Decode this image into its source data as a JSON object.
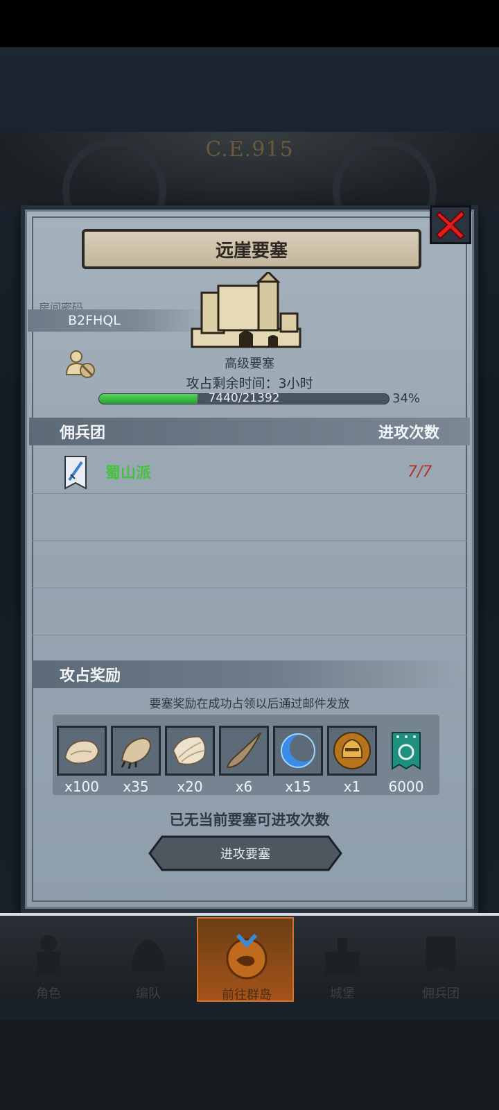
{
  "header": {
    "era": "C.E.915"
  },
  "dialog": {
    "title": "远崖要塞",
    "room_label": "房间密码",
    "room_code": "B2FHQL",
    "fortress_type": "高级要塞",
    "time_left": "攻占剩余时间：3小时",
    "progress": {
      "text": "7440/21392",
      "percent_label": "34%",
      "fraction": 0.34
    }
  },
  "mercenary_section": {
    "left_header": "佣兵团",
    "right_header": "进攻次数",
    "rows": [
      {
        "name": "蜀山派",
        "attacks": "7/7"
      }
    ]
  },
  "rewards": {
    "header": "攻占奖励",
    "note": "要塞奖励在成功占领以后通过邮件发放",
    "items": [
      {
        "icon": "fur-pelt-icon",
        "count": "x100"
      },
      {
        "icon": "beast-claw-icon",
        "count": "x35"
      },
      {
        "icon": "shell-scale-icon",
        "count": "x20"
      },
      {
        "icon": "horn-icon",
        "count": "x6"
      },
      {
        "icon": "blue-crescent-icon",
        "count": "x15"
      },
      {
        "icon": "golden-helmet-icon",
        "count": "x1"
      },
      {
        "icon": "guild-banner-icon",
        "count": "6000"
      }
    ]
  },
  "status_message": "已无当前要塞可进攻次数",
  "attack_button": "进攻要塞",
  "nav": [
    {
      "label": "角色",
      "icon": "knight-icon"
    },
    {
      "label": "编队",
      "icon": "helmet-icon"
    },
    {
      "label": "前往群岛",
      "icon": "island-emblem-icon",
      "active": true
    },
    {
      "label": "城堡",
      "icon": "castle-icon"
    },
    {
      "label": "佣兵团",
      "icon": "banner-icon"
    }
  ],
  "colors": {
    "accent_green": "#46c23f",
    "attack_red": "#b9302a",
    "active_tab": "#a5531a"
  }
}
